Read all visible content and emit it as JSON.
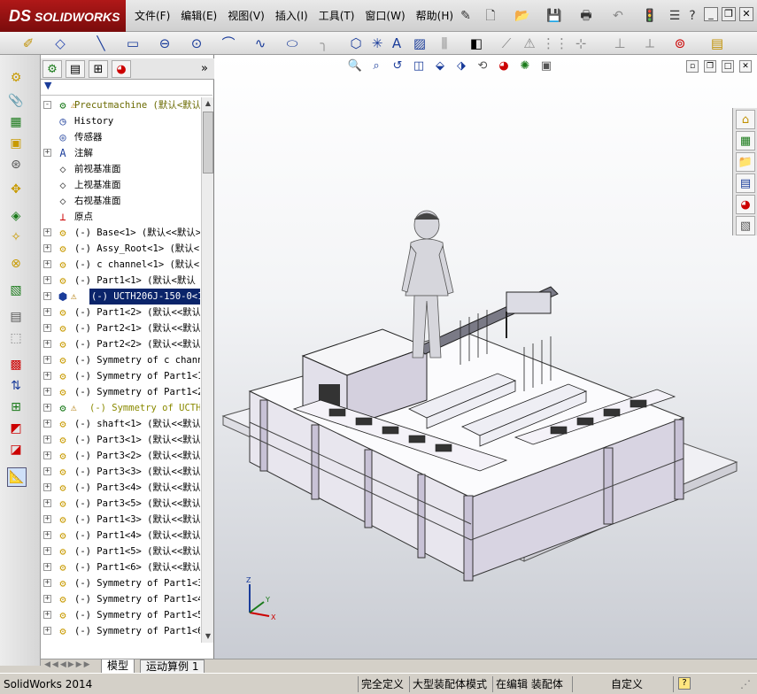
{
  "app": {
    "brand": "SOLIDWORKS",
    "brand_mark": "DS"
  },
  "menu": [
    "文件(F)",
    "编辑(E)",
    "视图(V)",
    "插入(I)",
    "工具(T)",
    "窗口(W)",
    "帮助(H)"
  ],
  "feature_manager": {
    "tree": [
      {
        "label": "Precutmachine  (默认<默认",
        "icon": "assembly-icon",
        "expander": "-",
        "top": true,
        "warn": true
      },
      {
        "label": "History",
        "icon": "history-icon"
      },
      {
        "label": "传感器",
        "icon": "sensor-icon"
      },
      {
        "label": "注解",
        "icon": "annotation-icon",
        "expander": "+"
      },
      {
        "label": "前视基准面",
        "icon": "plane-icon"
      },
      {
        "label": "上视基准面",
        "icon": "plane-icon"
      },
      {
        "label": "右视基准面",
        "icon": "plane-icon"
      },
      {
        "label": "原点",
        "icon": "origin-icon"
      },
      {
        "label": "(-) Base<1> (默认<<默认>",
        "icon": "subassembly-icon",
        "expander": "+"
      },
      {
        "label": "(-) Assy_Root<1> (默认<",
        "icon": "subassembly-icon",
        "expander": "+"
      },
      {
        "label": "(-) c channel<1> (默认<",
        "icon": "subassembly-icon",
        "expander": "+"
      },
      {
        "label": "(-) Part1<1> (默认<默认",
        "icon": "subassembly-icon",
        "expander": "+"
      },
      {
        "label": "(-) UCTH206J-150-0<1>",
        "icon": "part-blue-icon",
        "expander": "+",
        "warn": true,
        "selected": true
      },
      {
        "label": "(-) Part1<2> (默认<<默认",
        "icon": "subassembly-icon",
        "expander": "+"
      },
      {
        "label": "(-) Part2<1> (默认<<默认",
        "icon": "subassembly-icon",
        "expander": "+"
      },
      {
        "label": "(-) Part2<2> (默认<<默认",
        "icon": "subassembly-icon",
        "expander": "+"
      },
      {
        "label": "(-) Symmetry of c channe",
        "icon": "subassembly-icon",
        "expander": "+"
      },
      {
        "label": "(-) Symmetry of Part1<1",
        "icon": "subassembly-icon",
        "expander": "+"
      },
      {
        "label": "(-) Symmetry of Part1<2",
        "icon": "subassembly-icon",
        "expander": "+"
      },
      {
        "label": "(-) Symmetry of UCTH2",
        "icon": "subassembly-green-icon",
        "expander": "+",
        "warn": true,
        "yellow": true
      },
      {
        "label": "(-) shaft<1> (默认<<默认",
        "icon": "subassembly-icon",
        "expander": "+"
      },
      {
        "label": "(-) Part3<1> (默认<<默认",
        "icon": "subassembly-icon",
        "expander": "+"
      },
      {
        "label": "(-) Part3<2> (默认<<默认",
        "icon": "subassembly-icon",
        "expander": "+"
      },
      {
        "label": "(-) Part3<3> (默认<<默认",
        "icon": "subassembly-icon",
        "expander": "+"
      },
      {
        "label": "(-) Part3<4> (默认<<默认",
        "icon": "subassembly-icon",
        "expander": "+"
      },
      {
        "label": "(-) Part3<5> (默认<<默认",
        "icon": "subassembly-icon",
        "expander": "+"
      },
      {
        "label": "(-) Part1<3> (默认<<默认",
        "icon": "subassembly-icon",
        "expander": "+"
      },
      {
        "label": "(-) Part1<4> (默认<<默认",
        "icon": "subassembly-icon",
        "expander": "+"
      },
      {
        "label": "(-) Part1<5> (默认<<默认",
        "icon": "subassembly-icon",
        "expander": "+"
      },
      {
        "label": "(-) Part1<6> (默认<<默认",
        "icon": "subassembly-icon",
        "expander": "+"
      },
      {
        "label": "(-) Symmetry of Part1<3",
        "icon": "subassembly-icon",
        "expander": "+"
      },
      {
        "label": "(-) Symmetry of Part1<4",
        "icon": "subassembly-icon",
        "expander": "+"
      },
      {
        "label": "(-) Symmetry of Part1<5",
        "icon": "subassembly-icon",
        "expander": "+"
      },
      {
        "label": "(-) Symmetry of Part1<6",
        "icon": "subassembly-icon",
        "expander": "+"
      },
      {
        "label": "",
        "icon": "subassembly-icon",
        "expander": "+"
      }
    ]
  },
  "sheet_tabs": {
    "model": "模型",
    "motion": "运动算例 1"
  },
  "status": {
    "app_version": "SolidWorks 2014",
    "fully_defined": "完全定义",
    "large_assembly": "大型装配体模式",
    "editing": "在编辑 装配体",
    "custom": "自定义",
    "help": "?"
  },
  "triad": {
    "x": "X",
    "y": "Y",
    "z": "Z"
  },
  "colors": {
    "brand": "#a01010",
    "selection": "#0a246a",
    "part_yellow": "#e8c000",
    "machine_frame": "#b8b0c8"
  }
}
